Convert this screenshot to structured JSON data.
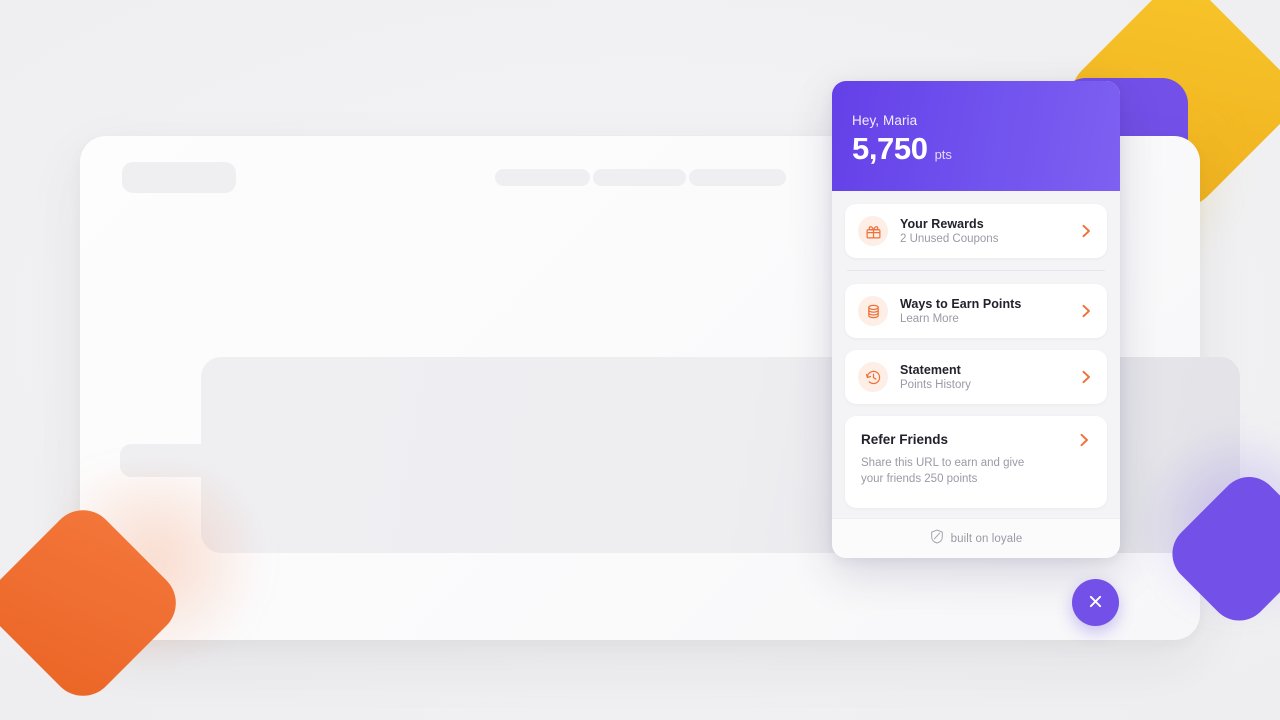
{
  "widget": {
    "header": {
      "greeting": "Hey, Maria",
      "points_value": "5,750",
      "points_unit": "pts",
      "gradient_from": "#6440e8",
      "gradient_to": "#7e60f2"
    },
    "rows": [
      {
        "icon": "gift-icon",
        "title": "Your Rewards",
        "subtitle": "2 Unused Coupons",
        "chevron": "chevron-right-icon"
      },
      {
        "icon": "coins-icon",
        "title": "Ways to Earn Points",
        "subtitle": "Learn More",
        "chevron": "chevron-right-icon"
      },
      {
        "icon": "history-clock-icon",
        "title": "Statement",
        "subtitle": "Points History",
        "chevron": "chevron-right-icon"
      }
    ],
    "refer": {
      "title": "Refer Friends",
      "description": "Share this URL to earn and give your friends 250 points",
      "chevron": "chevron-right-icon"
    },
    "footer": {
      "logo_icon": "loyale-shield-icon",
      "text": "built on loyale"
    },
    "accent_orange": "#f0703a",
    "accent_purple": "#7350e8"
  },
  "close_button": {
    "icon": "close-x-icon",
    "label": "Close",
    "color": "#7350e8"
  },
  "background": {
    "skeleton": {
      "logo": "",
      "nav_items": [
        "",
        "",
        ""
      ],
      "hero": "",
      "search": ""
    },
    "shapes": {
      "yellow": "#f2bc24",
      "purple": "#7350e8",
      "orange": "#ee6b2c"
    }
  }
}
